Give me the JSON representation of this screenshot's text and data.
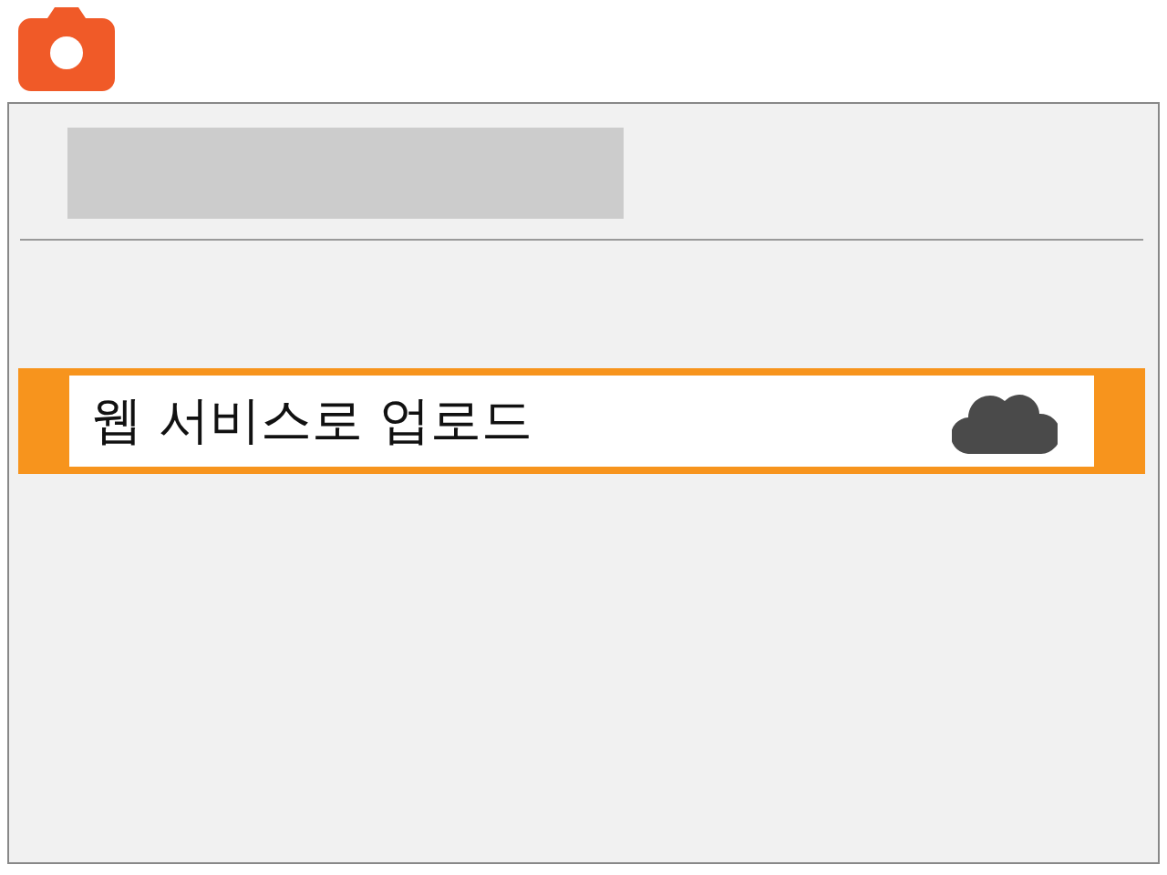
{
  "menu": {
    "items": [
      {
        "label": "웹 서비스로 업로드",
        "selected": true
      }
    ]
  }
}
